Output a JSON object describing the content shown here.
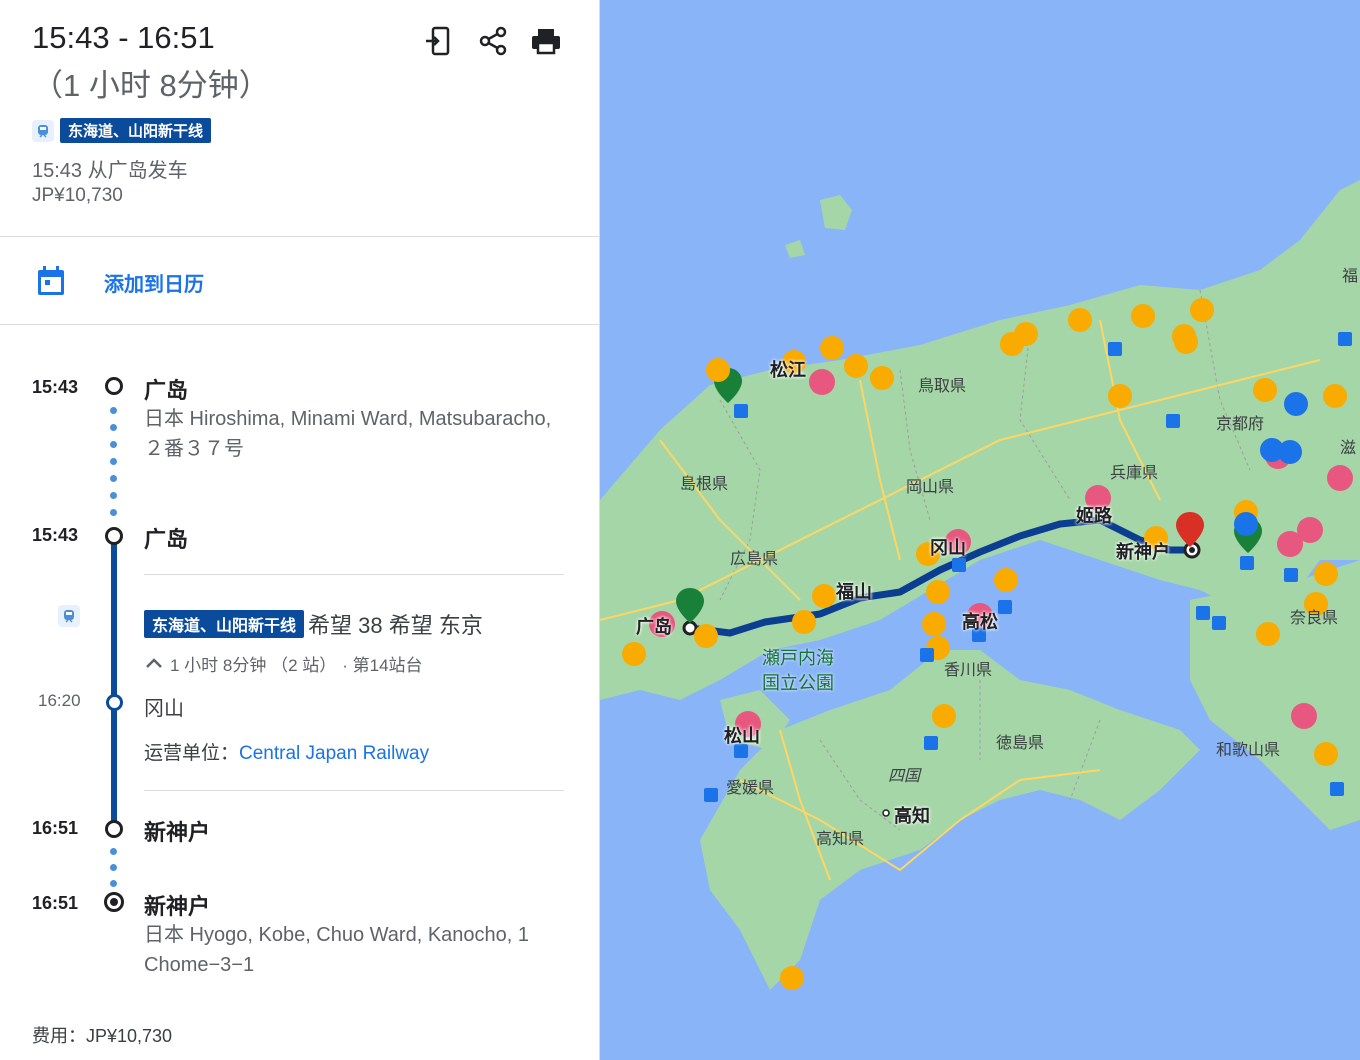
{
  "header": {
    "time_range": "15:43 - 16:51",
    "duration": "（1 小时 8分钟）",
    "line_name": "东海道、山阳新干线",
    "departure": "15:43 从广岛发车",
    "price": "JP¥10,730",
    "tools": [
      "send-to-phone-icon",
      "share-icon",
      "print-icon"
    ]
  },
  "calendar": {
    "label": "添加到日历"
  },
  "timeline": {
    "origin": {
      "time": "15:43",
      "name": "广岛",
      "address": "日本 Hiroshima, Minami Ward, Matsubaracho, ２番３７号"
    },
    "board": {
      "time": "15:43",
      "name": "广岛"
    },
    "train": {
      "line": "东海道、山阳新干线",
      "service": "希望 38 希望 东京",
      "summary": "1 小时 8分钟 （2 站）",
      "platform": "· 第14站台",
      "intermediate_time": "16:20",
      "intermediate_stop": "冈山",
      "operator_label": "运营单位：",
      "operator": "Central Japan Railway"
    },
    "alight": {
      "time": "16:51",
      "name": "新神户"
    },
    "destination": {
      "time": "16:51",
      "name": "新神户",
      "address": "日本 Hyogo, Kobe, Chuo Ward, Kanocho, 1 Chome−3−1"
    }
  },
  "footer": {
    "cost": "费用：JP¥10,730"
  },
  "map": {
    "labels": {
      "tottori": "鳥取県",
      "shimane": "島根県",
      "okayama_pref": "岡山県",
      "hiroshima_pref": "広島県",
      "hyogo": "兵庫県",
      "kyoto": "京都府",
      "shiga": "滋",
      "fukui": "福",
      "hiroshima_city": "广岛",
      "fukuyama": "福山",
      "okayama_city": "冈山",
      "himeji": "姬路",
      "shinkobe": "新神户",
      "nara": "奈良県",
      "wakayama": "和歌山県",
      "kagawa": "香川県",
      "takamatsu": "高松",
      "tokushima": "徳島県",
      "ehime": "愛媛県",
      "matsuyama": "松山",
      "shikoku": "四国",
      "kochi_city": "高知",
      "kochi_pref": "高知県",
      "matsue": "松江",
      "park_line1": "瀬戸内海",
      "park_line2": "国立公園"
    },
    "colors": {
      "water": "#8ab4f8",
      "land": "#a5d6a7",
      "route": "#0b3d91",
      "roads": "#fdd663"
    }
  }
}
